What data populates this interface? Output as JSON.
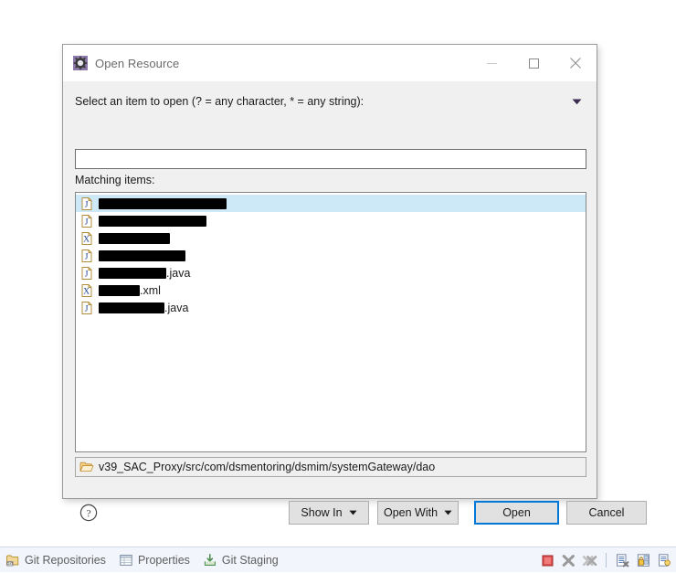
{
  "dialog": {
    "title": "Open Resource",
    "title_icon": "resource-gear-icon",
    "window_controls": {
      "minimize": "minimize-icon",
      "maximize": "maximize-icon",
      "close": "close-icon"
    },
    "prompt": "Select an item to open (? = any character, * = any string):",
    "prompt_caret_icon": "chevron-down-icon",
    "filter_input": {
      "value": "",
      "placeholder": ""
    },
    "matching_items_label": "Matching items:",
    "list": [
      {
        "icon": "java-file-icon",
        "redacted_width": 140,
        "suffix": "",
        "selected": true
      },
      {
        "icon": "java-file-icon",
        "redacted_width": 118,
        "suffix": "",
        "selected": false
      },
      {
        "icon": "xml-file-icon",
        "redacted_width": 78,
        "suffix": "",
        "selected": false
      },
      {
        "icon": "java-file-icon",
        "redacted_width": 95,
        "suffix": "",
        "selected": false
      },
      {
        "icon": "java-file-icon",
        "redacted_width": 74,
        "suffix": ".java",
        "selected": false
      },
      {
        "icon": "xml-file-icon",
        "redacted_width": 45,
        "suffix": ".xml",
        "selected": false
      },
      {
        "icon": "java-file-icon",
        "redacted_width": 72,
        "suffix": ".java",
        "selected": false
      }
    ],
    "path_bar": {
      "icon": "open-folder-icon",
      "path": "v39_SAC_Proxy/src/com/dsmentoring/dsmim/systemGateway/dao"
    },
    "buttons": {
      "help_icon": "help-circle-icon",
      "show_in": "Show In",
      "open_with": "Open With",
      "open": "Open",
      "cancel": "Cancel"
    },
    "colors": {
      "focus_border": "#0078d7",
      "selection": "#cde8f6",
      "title_icon": "#7a6496"
    }
  },
  "bottom_bar": {
    "tabs": [
      {
        "icon": "git-repositories-icon",
        "label": "Git Repositories"
      },
      {
        "icon": "properties-icon",
        "label": "Properties"
      },
      {
        "icon": "git-staging-icon",
        "label": "Git Staging"
      }
    ],
    "tools": [
      {
        "icon": "terminate-icon"
      },
      {
        "icon": "remove-launch-icon"
      },
      {
        "icon": "remove-all-terminated-icon"
      },
      {
        "icon": "divider"
      },
      {
        "icon": "remove-console-icon"
      },
      {
        "icon": "pin-console-icon"
      },
      {
        "icon": "open-console-icon"
      }
    ]
  }
}
